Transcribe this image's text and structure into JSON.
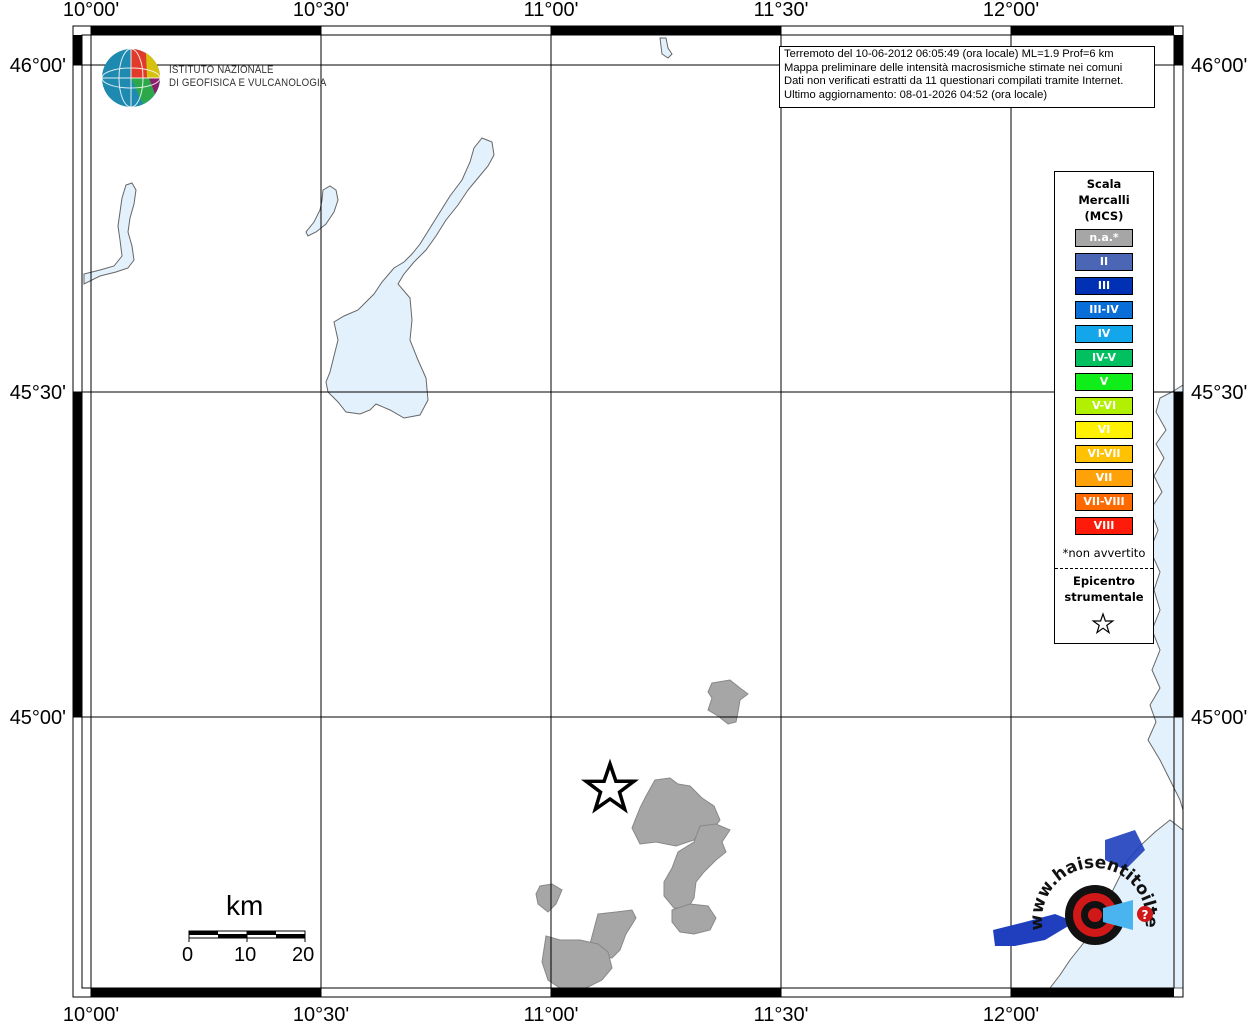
{
  "map": {
    "grid_lon_labels": [
      "10°00'",
      "10°30'",
      "11°00'",
      "11°30'",
      "12°00'"
    ],
    "grid_lat_labels": [
      "46°00'",
      "45°30'",
      "45°00'"
    ],
    "land_color": "#ffffff",
    "water_color": "#e3f1fc",
    "municipality_color": "#a6a6a6"
  },
  "info": {
    "line1": "Terremoto del 10-06-2012 06:05:49 (ora locale) ML=1.9 Prof=6 km",
    "line2": "Mappa preliminare delle intensità macrosismiche stimate nei comuni",
    "line3": "Dati non verificati estratti da 11 questionari compilati tramite Internet.",
    "line4": "Ultimo aggiornamento: 08-01-2026 04:52 (ora locale)"
  },
  "legend": {
    "title1": "Scala",
    "title2": "Mercalli",
    "title3": "(MCS)",
    "items": [
      {
        "label": "n.a.*",
        "color": "#a6a6a6"
      },
      {
        "label": "II",
        "color": "#4a66b5"
      },
      {
        "label": "III",
        "color": "#0030b4"
      },
      {
        "label": "III-IV",
        "color": "#0a6ed8"
      },
      {
        "label": "IV",
        "color": "#13a6ea"
      },
      {
        "label": "IV-V",
        "color": "#00c060"
      },
      {
        "label": "V",
        "color": "#10ee1a"
      },
      {
        "label": "V-VI",
        "color": "#b0f000"
      },
      {
        "label": "VI",
        "color": "#fff200"
      },
      {
        "label": "VI-VII",
        "color": "#ffc200"
      },
      {
        "label": "VII",
        "color": "#ffa20a"
      },
      {
        "label": "VII-VIII",
        "color": "#ff6a00"
      },
      {
        "label": "VIII",
        "color": "#ff1a0a"
      }
    ],
    "note": "*non avvertito",
    "epicentre1": "Epicentro",
    "epicentre2": "strumentale",
    "epicentre_icon": "star-outline-icon"
  },
  "logo": {
    "line1": "ISTITUTO NAZIONALE",
    "line2": "DI GEOFISICA E VULCANOLOGIA"
  },
  "scalebar": {
    "unit": "km",
    "labels": [
      "0",
      "10",
      "20"
    ]
  },
  "watermark": {
    "text": "www.haisentitoilterremoto.it"
  }
}
